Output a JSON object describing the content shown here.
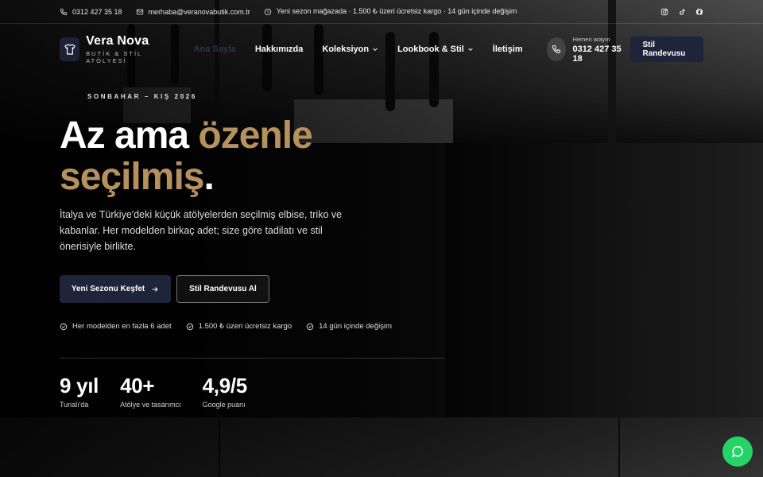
{
  "topbar": {
    "phone": "0312 427 35 18",
    "email": "merhaba@veranovabutik.com.tr",
    "notice": "Yeni sezon mağazada · 1.500 ₺ üzeri ücretsiz kargo · 14 gün içinde değişim",
    "social": [
      "instagram-icon",
      "tiktok-icon",
      "facebook-icon"
    ]
  },
  "brand": {
    "name": "Vera Nova",
    "tagline": "BUTİK & STİL ATÖLYESİ"
  },
  "nav": {
    "items": [
      {
        "label": "Ana Sayfa",
        "active": true,
        "dropdown": false
      },
      {
        "label": "Hakkımızda",
        "active": false,
        "dropdown": false
      },
      {
        "label": "Koleksiyon",
        "active": false,
        "dropdown": true
      },
      {
        "label": "Lookbook & Stil",
        "active": false,
        "dropdown": true
      },
      {
        "label": "İletişim",
        "active": false,
        "dropdown": false
      }
    ]
  },
  "call": {
    "label": "Hemen arayın",
    "number": "0312 427 35 18"
  },
  "header_cta": "Stil Randevusu",
  "hero": {
    "season": "SONBAHAR – KIŞ 2026",
    "headline_white_1": "Az ama ",
    "headline_gold_1": "özenle",
    "headline_gold_2": "seçilmiş",
    "headline_white_2": ".",
    "lead": "İtalya ve Türkiye'deki küçük atölyelerden seçilmiş elbise, triko ve kabanlar. Her modelden birkaç adet; size göre tadilatı ve stil önerisiyle birlikte.",
    "primary_button": "Yeni Sezonu Keşfet",
    "secondary_button": "Stil Randevusu Al",
    "perks": [
      "Her modelden en fazla 6 adet",
      "1.500 ₺ üzeri ücretsiz kargo",
      "14 gün içinde değişim"
    ],
    "stats": [
      {
        "value": "9 yıl",
        "label": "Tunalı'da"
      },
      {
        "value": "40+",
        "label": "Atölye ve tasarımcı"
      },
      {
        "value": "4,9/5",
        "label": "Google puanı"
      }
    ]
  },
  "colors": {
    "accent_gold": "#b5915e",
    "navy": "#1e2439",
    "whatsapp_green": "#25d366"
  }
}
